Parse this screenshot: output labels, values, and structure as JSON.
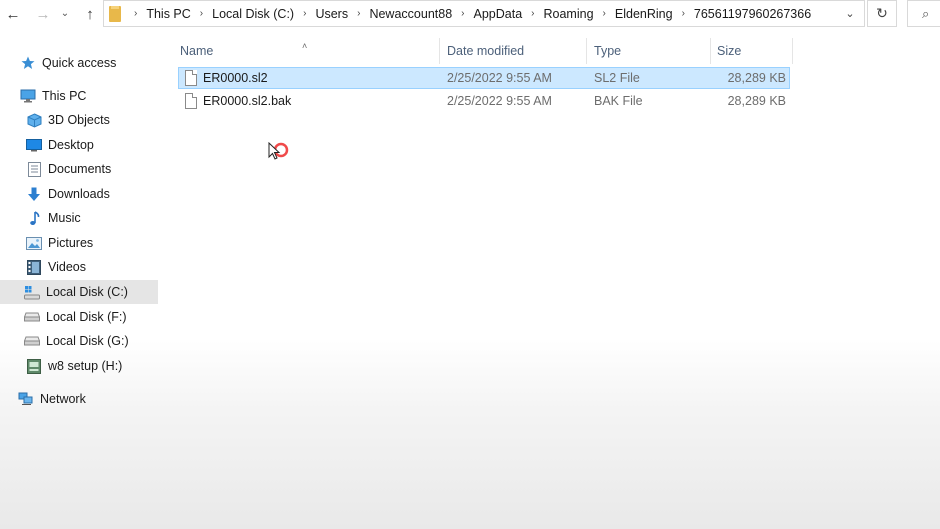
{
  "navigation": {
    "back_icon": "←",
    "forward_icon": "→",
    "recent_icon": "⌄",
    "up_icon": "↑"
  },
  "address_bar": {
    "breadcrumbs": [
      "This PC",
      "Local Disk (C:)",
      "Users",
      "Newaccount88",
      "AppData",
      "Roaming",
      "EldenRing",
      "76561197960267366"
    ],
    "separator": "›",
    "dropdown_icon": "⌄",
    "refresh_icon": "↻",
    "search_icon": "⌕"
  },
  "sidebar": {
    "items": [
      {
        "label": "Quick access",
        "icon": "star-icon"
      },
      {
        "label": "This PC",
        "icon": "pc-icon"
      },
      {
        "label": "3D Objects",
        "icon": "3d-objects-icon"
      },
      {
        "label": "Desktop",
        "icon": "desktop-icon"
      },
      {
        "label": "Documents",
        "icon": "documents-icon"
      },
      {
        "label": "Downloads",
        "icon": "downloads-icon"
      },
      {
        "label": "Music",
        "icon": "music-icon"
      },
      {
        "label": "Pictures",
        "icon": "pictures-icon"
      },
      {
        "label": "Videos",
        "icon": "videos-icon"
      },
      {
        "label": "Local Disk (C:)",
        "icon": "windows-drive-icon",
        "selected": true
      },
      {
        "label": "Local Disk (F:)",
        "icon": "drive-icon"
      },
      {
        "label": "Local Disk (G:)",
        "icon": "drive-icon"
      },
      {
        "label": "w8 setup (H:)",
        "icon": "setup-drive-icon"
      },
      {
        "label": "Network",
        "icon": "network-icon"
      }
    ]
  },
  "file_list": {
    "columns": {
      "name": "Name",
      "date": "Date modified",
      "type": "Type",
      "size": "Size"
    },
    "sort_icon": "˄",
    "rows": [
      {
        "name": "ER0000.sl2",
        "date": "2/25/2022 9:55 AM",
        "type": "SL2 File",
        "size": "28,289 KB",
        "selected": true
      },
      {
        "name": "ER0000.sl2.bak",
        "date": "2/25/2022 9:55 AM",
        "type": "BAK File",
        "size": "28,289 KB",
        "selected": false
      }
    ]
  },
  "colors": {
    "selection_bg": "#cce8ff",
    "selection_border": "#99d1ff",
    "header_text": "#4c607a",
    "sidebar_selected": "#e5e5e5"
  }
}
